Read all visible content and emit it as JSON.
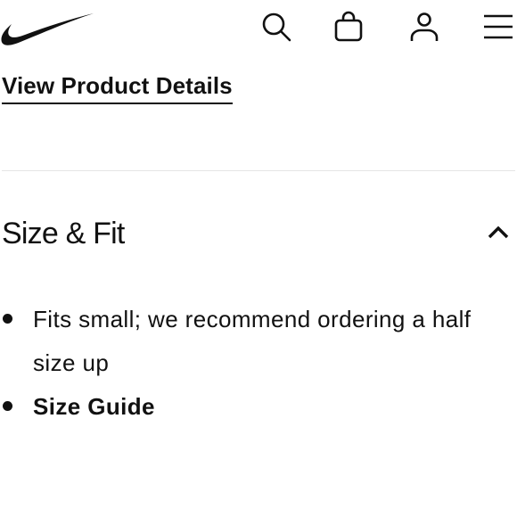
{
  "header": {
    "logo_name": "swoosh-logo",
    "icons": {
      "search": "search-icon",
      "bag": "bag-icon",
      "profile": "profile-icon",
      "menu": "hamburger-menu-icon"
    }
  },
  "product": {
    "details_link": "View Product Details"
  },
  "size_fit": {
    "title": "Size & Fit",
    "expanded": true,
    "chevron_icon": "chevron-up-icon",
    "bullets": [
      "Fits small; we recommend ordering a half size up"
    ],
    "size_guide_label": "Size Guide"
  }
}
